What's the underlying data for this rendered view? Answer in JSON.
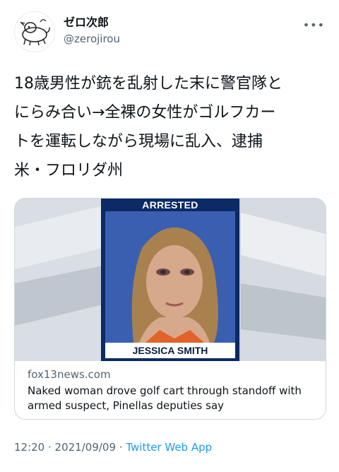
{
  "user": {
    "display_name": "ゼロ次郎",
    "handle": "@zerojirou"
  },
  "more_icon": "more-icon",
  "tweet": {
    "text": "18歳男性が銃を乱射した末に警官隊と\nにらみ合い→全裸の女性がゴルフカー\nトを運転しながら現場に乱入、逮捕\n米・フロリダ州"
  },
  "card": {
    "image_banner": "ARRESTED",
    "image_name": "JESSICA SMITH",
    "domain": "fox13news.com",
    "title": "Naked woman drove golf cart through standoff with armed suspect, Pinellas deputies say"
  },
  "footer": {
    "time": "12:20",
    "separator1": " · ",
    "date": "2021/09/09",
    "separator2": " · ",
    "app": "Twitter Web App"
  },
  "colors": {
    "accent": "#1d9bf0",
    "mugshot_frame": "#0b2a66"
  }
}
